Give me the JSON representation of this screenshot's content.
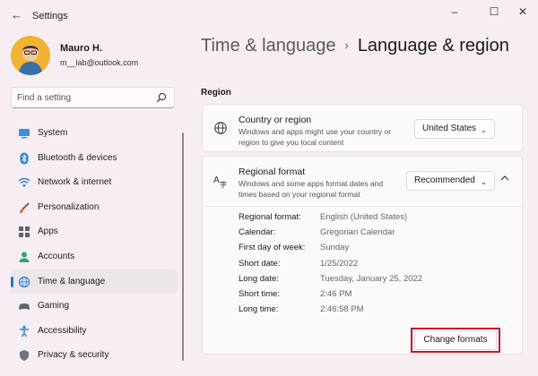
{
  "window": {
    "title": "Settings",
    "back_icon": "back-arrow-icon",
    "controls": [
      "minimize-icon",
      "maximize-icon",
      "close-icon"
    ]
  },
  "profile": {
    "name": "Mauro H.",
    "email": "m__lab@outlook.com"
  },
  "search": {
    "placeholder": "Find a setting"
  },
  "sidebar": {
    "items": [
      {
        "label": "System",
        "icon": "monitor-icon"
      },
      {
        "label": "Bluetooth & devices",
        "icon": "bluetooth-icon"
      },
      {
        "label": "Network & internet",
        "icon": "wifi-icon"
      },
      {
        "label": "Personalization",
        "icon": "brush-icon"
      },
      {
        "label": "Apps",
        "icon": "apps-grid-icon"
      },
      {
        "label": "Accounts",
        "icon": "person-icon"
      },
      {
        "label": "Time & language",
        "icon": "globe-clock-icon",
        "active": true
      },
      {
        "label": "Gaming",
        "icon": "gamepad-icon"
      },
      {
        "label": "Accessibility",
        "icon": "accessibility-icon"
      },
      {
        "label": "Privacy & security",
        "icon": "shield-icon"
      }
    ]
  },
  "breadcrumb": {
    "parent": "Time & language",
    "separator": "›",
    "current": "Language & region"
  },
  "main": {
    "section_title": "Region",
    "country": {
      "title": "Country or region",
      "description": "Windows and apps might use your country or region to give you local content",
      "value": "United States"
    },
    "regional_format": {
      "title": "Regional format",
      "description": "Windows and some apps format dates and times based on your regional format",
      "value": "Recommended",
      "details": [
        {
          "label": "Regional format:",
          "value": "English (United States)"
        },
        {
          "label": "Calendar:",
          "value": "Gregorian Calendar"
        },
        {
          "label": "First day of week:",
          "value": "Sunday"
        },
        {
          "label": "Short date:",
          "value": "1/25/2022"
        },
        {
          "label": "Long date:",
          "value": "Tuesday, January 25, 2022"
        },
        {
          "label": "Short time:",
          "value": "2:46 PM"
        },
        {
          "label": "Long time:",
          "value": "2:46:58 PM"
        }
      ],
      "change_button": "Change formats"
    }
  },
  "colors": {
    "accent": "#2a78c7",
    "highlight": "#b91c2c",
    "background": "#f6eef2"
  }
}
